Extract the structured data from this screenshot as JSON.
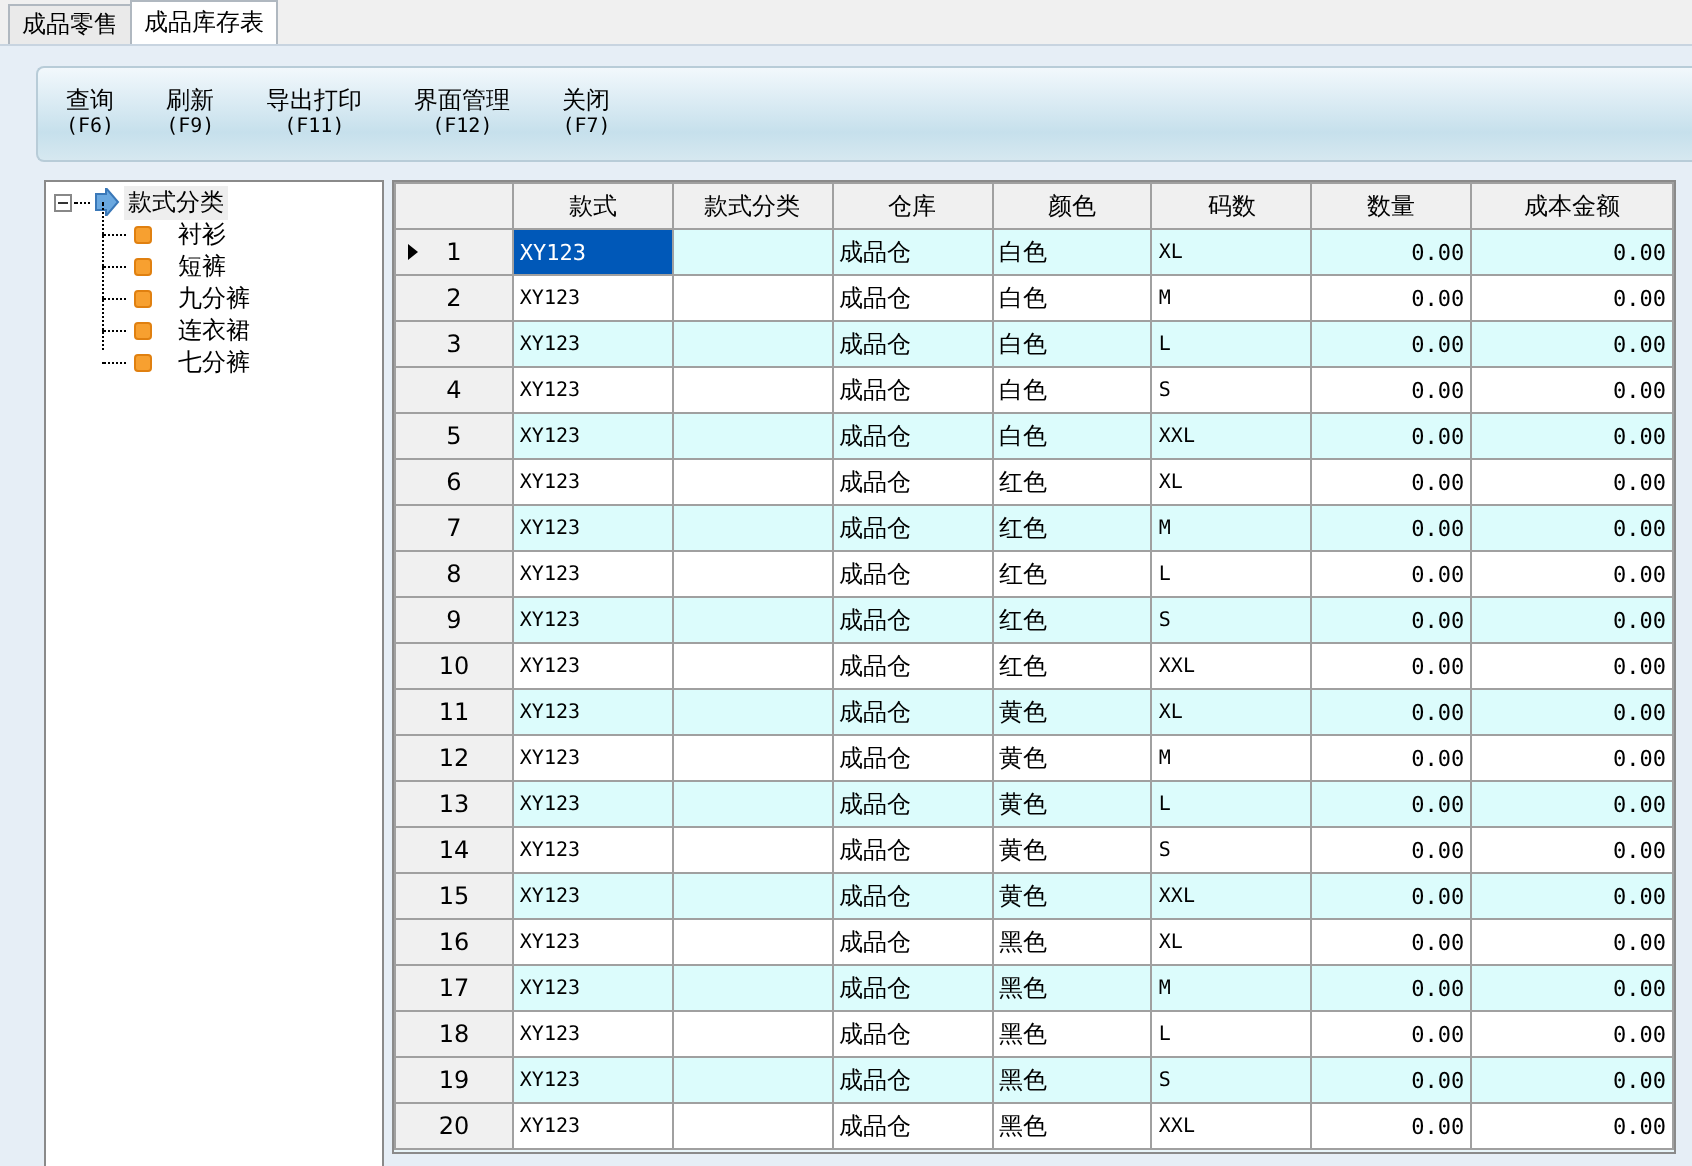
{
  "tabs": [
    {
      "label": "成品零售",
      "selected": false
    },
    {
      "label": "成品库存表",
      "selected": true
    }
  ],
  "toolbar": [
    {
      "label": "查询",
      "key": "(F6)"
    },
    {
      "label": "刷新",
      "key": "(F9)"
    },
    {
      "label": "导出打印",
      "key": "(F11)"
    },
    {
      "label": "界面管理",
      "key": "(F12)"
    },
    {
      "label": "关闭",
      "key": "(F7)"
    }
  ],
  "tree": {
    "label": "款式分类",
    "expanded": true,
    "selected": true,
    "children": [
      {
        "label": "衬衫",
        "selected": false
      },
      {
        "label": "短裤",
        "selected": false
      },
      {
        "label": "九分裤",
        "selected": false
      },
      {
        "label": "连衣裙",
        "selected": false
      },
      {
        "label": "七分裤",
        "selected": false
      }
    ]
  },
  "table": {
    "columns": [
      "款式",
      "款式分类",
      "仓库",
      "颜色",
      "码数",
      "数量",
      "成本金额"
    ],
    "rows": [
      {
        "number": "1",
        "current": true,
        "cells": [
          "XY123",
          "",
          "成品仓",
          "白色",
          "XL",
          "0.00",
          "0.00"
        ]
      },
      {
        "number": "2",
        "current": false,
        "cells": [
          "XY123",
          "",
          "成品仓",
          "白色",
          "M",
          "0.00",
          "0.00"
        ]
      },
      {
        "number": "3",
        "current": false,
        "cells": [
          "XY123",
          "",
          "成品仓",
          "白色",
          "L",
          "0.00",
          "0.00"
        ]
      },
      {
        "number": "4",
        "current": false,
        "cells": [
          "XY123",
          "",
          "成品仓",
          "白色",
          "S",
          "0.00",
          "0.00"
        ]
      },
      {
        "number": "5",
        "current": false,
        "cells": [
          "XY123",
          "",
          "成品仓",
          "白色",
          "XXL",
          "0.00",
          "0.00"
        ]
      },
      {
        "number": "6",
        "current": false,
        "cells": [
          "XY123",
          "",
          "成品仓",
          "红色",
          "XL",
          "0.00",
          "0.00"
        ]
      },
      {
        "number": "7",
        "current": false,
        "cells": [
          "XY123",
          "",
          "成品仓",
          "红色",
          "M",
          "0.00",
          "0.00"
        ]
      },
      {
        "number": "8",
        "current": false,
        "cells": [
          "XY123",
          "",
          "成品仓",
          "红色",
          "L",
          "0.00",
          "0.00"
        ]
      },
      {
        "number": "9",
        "current": false,
        "cells": [
          "XY123",
          "",
          "成品仓",
          "红色",
          "S",
          "0.00",
          "0.00"
        ]
      },
      {
        "number": "10",
        "current": false,
        "cells": [
          "XY123",
          "",
          "成品仓",
          "红色",
          "XXL",
          "0.00",
          "0.00"
        ]
      },
      {
        "number": "11",
        "current": false,
        "cells": [
          "XY123",
          "",
          "成品仓",
          "黄色",
          "XL",
          "0.00",
          "0.00"
        ]
      },
      {
        "number": "12",
        "current": false,
        "cells": [
          "XY123",
          "",
          "成品仓",
          "黄色",
          "M",
          "0.00",
          "0.00"
        ]
      },
      {
        "number": "13",
        "current": false,
        "cells": [
          "XY123",
          "",
          "成品仓",
          "黄色",
          "L",
          "0.00",
          "0.00"
        ]
      },
      {
        "number": "14",
        "current": false,
        "cells": [
          "XY123",
          "",
          "成品仓",
          "黄色",
          "S",
          "0.00",
          "0.00"
        ]
      },
      {
        "number": "15",
        "current": false,
        "cells": [
          "XY123",
          "",
          "成品仓",
          "黄色",
          "XXL",
          "0.00",
          "0.00"
        ]
      },
      {
        "number": "16",
        "current": false,
        "cells": [
          "XY123",
          "",
          "成品仓",
          "黑色",
          "XL",
          "0.00",
          "0.00"
        ]
      },
      {
        "number": "17",
        "current": false,
        "cells": [
          "XY123",
          "",
          "成品仓",
          "黑色",
          "M",
          "0.00",
          "0.00"
        ]
      },
      {
        "number": "18",
        "current": false,
        "cells": [
          "XY123",
          "",
          "成品仓",
          "黑色",
          "L",
          "0.00",
          "0.00"
        ]
      },
      {
        "number": "19",
        "current": false,
        "cells": [
          "XY123",
          "",
          "成品仓",
          "黑色",
          "S",
          "0.00",
          "0.00"
        ]
      },
      {
        "number": "20",
        "current": false,
        "cells": [
          "XY123",
          "",
          "成品仓",
          "黑色",
          "XXL",
          "0.00",
          "0.00"
        ]
      }
    ]
  }
}
